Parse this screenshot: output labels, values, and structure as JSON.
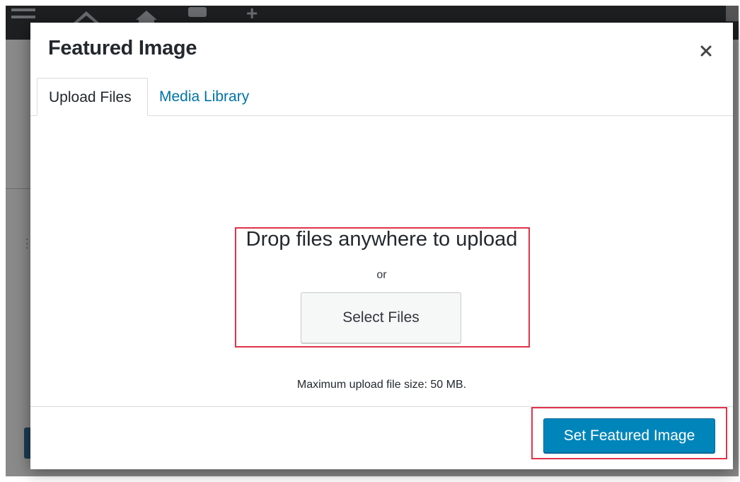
{
  "modal": {
    "title": "Featured Image",
    "tabs": [
      {
        "label": "Upload Files",
        "active": true
      },
      {
        "label": "Media Library",
        "active": false
      }
    ],
    "uploader": {
      "drop_text": "Drop files anywhere to upload",
      "or_text": "or",
      "select_button": "Select Files",
      "max_size_text": "Maximum upload file size: 50 MB."
    },
    "footer": {
      "primary_button": "Set Featured Image"
    }
  },
  "icons": {
    "close": "close-icon"
  },
  "colors": {
    "accent": "#0085ba",
    "link": "#0073aa",
    "highlight": "#e0334a"
  }
}
